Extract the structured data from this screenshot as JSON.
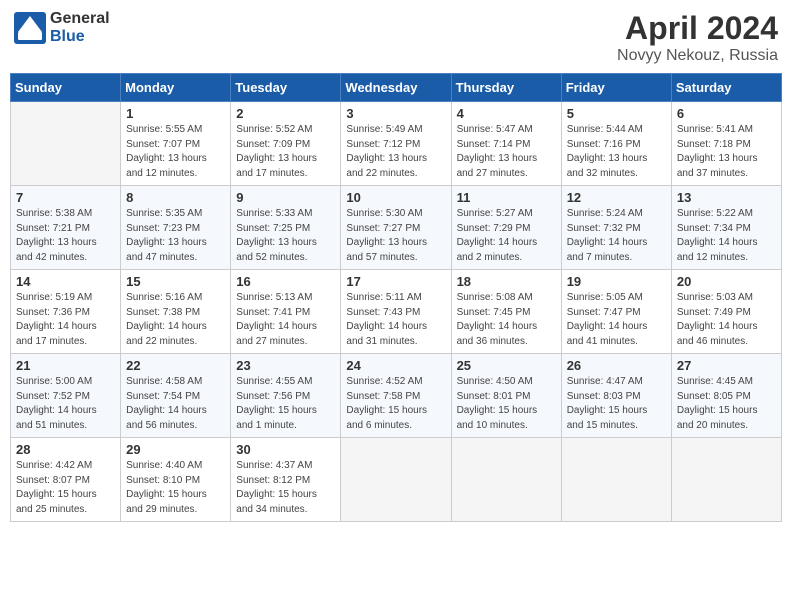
{
  "logo": {
    "general": "General",
    "blue": "Blue"
  },
  "title": "April 2024",
  "subtitle": "Novyy Nekouz, Russia",
  "headers": [
    "Sunday",
    "Monday",
    "Tuesday",
    "Wednesday",
    "Thursday",
    "Friday",
    "Saturday"
  ],
  "weeks": [
    [
      {
        "day": "",
        "info": ""
      },
      {
        "day": "1",
        "info": "Sunrise: 5:55 AM\nSunset: 7:07 PM\nDaylight: 13 hours\nand 12 minutes."
      },
      {
        "day": "2",
        "info": "Sunrise: 5:52 AM\nSunset: 7:09 PM\nDaylight: 13 hours\nand 17 minutes."
      },
      {
        "day": "3",
        "info": "Sunrise: 5:49 AM\nSunset: 7:12 PM\nDaylight: 13 hours\nand 22 minutes."
      },
      {
        "day": "4",
        "info": "Sunrise: 5:47 AM\nSunset: 7:14 PM\nDaylight: 13 hours\nand 27 minutes."
      },
      {
        "day": "5",
        "info": "Sunrise: 5:44 AM\nSunset: 7:16 PM\nDaylight: 13 hours\nand 32 minutes."
      },
      {
        "day": "6",
        "info": "Sunrise: 5:41 AM\nSunset: 7:18 PM\nDaylight: 13 hours\nand 37 minutes."
      }
    ],
    [
      {
        "day": "7",
        "info": "Sunrise: 5:38 AM\nSunset: 7:21 PM\nDaylight: 13 hours\nand 42 minutes."
      },
      {
        "day": "8",
        "info": "Sunrise: 5:35 AM\nSunset: 7:23 PM\nDaylight: 13 hours\nand 47 minutes."
      },
      {
        "day": "9",
        "info": "Sunrise: 5:33 AM\nSunset: 7:25 PM\nDaylight: 13 hours\nand 52 minutes."
      },
      {
        "day": "10",
        "info": "Sunrise: 5:30 AM\nSunset: 7:27 PM\nDaylight: 13 hours\nand 57 minutes."
      },
      {
        "day": "11",
        "info": "Sunrise: 5:27 AM\nSunset: 7:29 PM\nDaylight: 14 hours\nand 2 minutes."
      },
      {
        "day": "12",
        "info": "Sunrise: 5:24 AM\nSunset: 7:32 PM\nDaylight: 14 hours\nand 7 minutes."
      },
      {
        "day": "13",
        "info": "Sunrise: 5:22 AM\nSunset: 7:34 PM\nDaylight: 14 hours\nand 12 minutes."
      }
    ],
    [
      {
        "day": "14",
        "info": "Sunrise: 5:19 AM\nSunset: 7:36 PM\nDaylight: 14 hours\nand 17 minutes."
      },
      {
        "day": "15",
        "info": "Sunrise: 5:16 AM\nSunset: 7:38 PM\nDaylight: 14 hours\nand 22 minutes."
      },
      {
        "day": "16",
        "info": "Sunrise: 5:13 AM\nSunset: 7:41 PM\nDaylight: 14 hours\nand 27 minutes."
      },
      {
        "day": "17",
        "info": "Sunrise: 5:11 AM\nSunset: 7:43 PM\nDaylight: 14 hours\nand 31 minutes."
      },
      {
        "day": "18",
        "info": "Sunrise: 5:08 AM\nSunset: 7:45 PM\nDaylight: 14 hours\nand 36 minutes."
      },
      {
        "day": "19",
        "info": "Sunrise: 5:05 AM\nSunset: 7:47 PM\nDaylight: 14 hours\nand 41 minutes."
      },
      {
        "day": "20",
        "info": "Sunrise: 5:03 AM\nSunset: 7:49 PM\nDaylight: 14 hours\nand 46 minutes."
      }
    ],
    [
      {
        "day": "21",
        "info": "Sunrise: 5:00 AM\nSunset: 7:52 PM\nDaylight: 14 hours\nand 51 minutes."
      },
      {
        "day": "22",
        "info": "Sunrise: 4:58 AM\nSunset: 7:54 PM\nDaylight: 14 hours\nand 56 minutes."
      },
      {
        "day": "23",
        "info": "Sunrise: 4:55 AM\nSunset: 7:56 PM\nDaylight: 15 hours\nand 1 minute."
      },
      {
        "day": "24",
        "info": "Sunrise: 4:52 AM\nSunset: 7:58 PM\nDaylight: 15 hours\nand 6 minutes."
      },
      {
        "day": "25",
        "info": "Sunrise: 4:50 AM\nSunset: 8:01 PM\nDaylight: 15 hours\nand 10 minutes."
      },
      {
        "day": "26",
        "info": "Sunrise: 4:47 AM\nSunset: 8:03 PM\nDaylight: 15 hours\nand 15 minutes."
      },
      {
        "day": "27",
        "info": "Sunrise: 4:45 AM\nSunset: 8:05 PM\nDaylight: 15 hours\nand 20 minutes."
      }
    ],
    [
      {
        "day": "28",
        "info": "Sunrise: 4:42 AM\nSunset: 8:07 PM\nDaylight: 15 hours\nand 25 minutes."
      },
      {
        "day": "29",
        "info": "Sunrise: 4:40 AM\nSunset: 8:10 PM\nDaylight: 15 hours\nand 29 minutes."
      },
      {
        "day": "30",
        "info": "Sunrise: 4:37 AM\nSunset: 8:12 PM\nDaylight: 15 hours\nand 34 minutes."
      },
      {
        "day": "",
        "info": ""
      },
      {
        "day": "",
        "info": ""
      },
      {
        "day": "",
        "info": ""
      },
      {
        "day": "",
        "info": ""
      }
    ]
  ]
}
